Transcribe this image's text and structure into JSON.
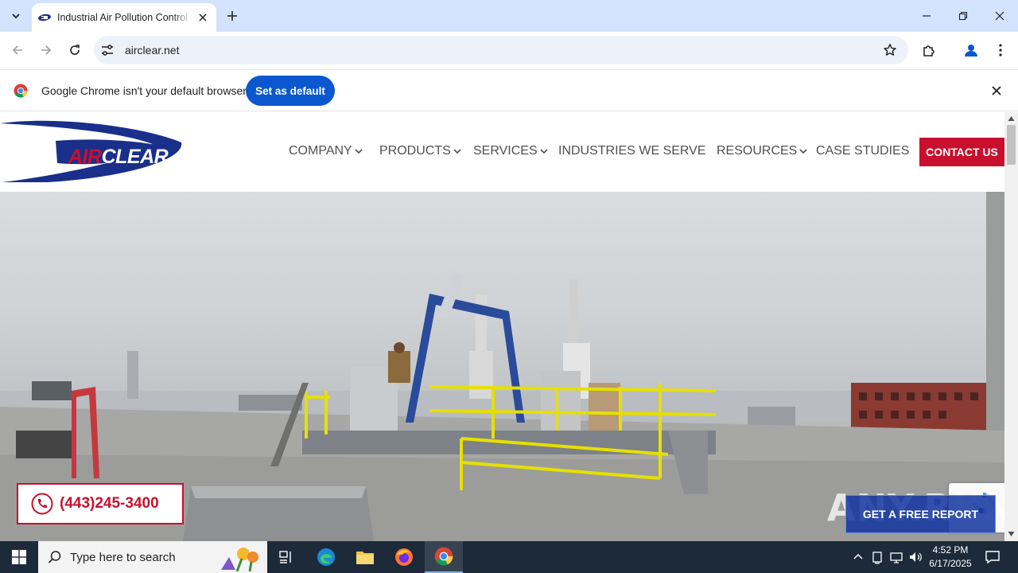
{
  "browser": {
    "tab_title": "Industrial Air Pollution Control S",
    "url": "airclear.net",
    "infobar_text": "Google Chrome isn't your default browser",
    "set_default_label": "Set as default"
  },
  "site": {
    "logo_air": "AIR",
    "logo_clear": "CLEAR",
    "nav": [
      {
        "label": "COMPANY",
        "dropdown": true
      },
      {
        "label": "PRODUCTS",
        "dropdown": true
      },
      {
        "label": "SERVICES",
        "dropdown": true
      },
      {
        "label": "INDUSTRIES WE SERVE",
        "dropdown": false
      },
      {
        "label": "RESOURCES",
        "dropdown": true
      },
      {
        "label": "CASE STUDIES",
        "dropdown": false
      }
    ],
    "contact_label": "CONTACT US",
    "phone": "(443)245-3400",
    "report_label": "GET A FREE REPORT",
    "watermark": "ANY.RUN"
  },
  "taskbar": {
    "search_placeholder": "Type here to search",
    "time": "4:52 PM",
    "date": "6/17/2025"
  },
  "colors": {
    "brand_red": "#c8102e",
    "brand_navy": "#1a2f8a",
    "chrome_blue": "#0b57d0"
  }
}
